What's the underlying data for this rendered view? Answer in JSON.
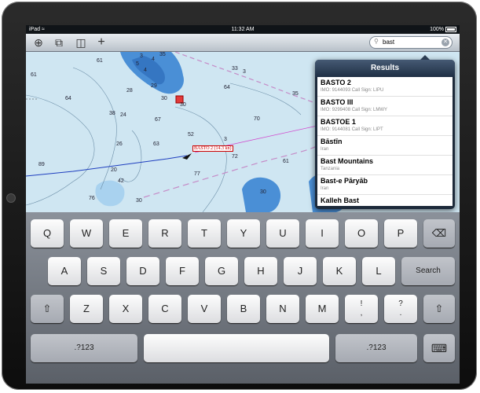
{
  "status_bar": {
    "device": "iPad",
    "wifi_icon": "wifi-icon",
    "time": "11:32 AM",
    "battery": "100%"
  },
  "toolbar": {
    "icons": [
      "location-target-icon",
      "layers-icon",
      "book-icon",
      "add-icon"
    ],
    "search": {
      "value": "bast",
      "icon": "search-icon",
      "clear_icon": "clear-icon"
    }
  },
  "map": {
    "depths": [
      "61",
      "3",
      "4",
      "35",
      "5",
      "4",
      "61",
      "33",
      "3",
      "64",
      "29",
      "30",
      "28",
      "64",
      "30",
      "35",
      "38",
      "24",
      "67",
      "70",
      "26",
      "63",
      "52",
      "3",
      "72",
      "89",
      "20",
      "42",
      "77",
      "76",
      "30",
      "61",
      "30"
    ],
    "vessel_label": "BASTO 2 (14.3 kn)"
  },
  "results_panel": {
    "title": "Results",
    "items": [
      {
        "name": "BASTO 2",
        "sub": "IMO: 9144093 Call Sign: LIPU"
      },
      {
        "name": "BASTO III",
        "sub": "IMO: 9299408 Call Sign: LMWY"
      },
      {
        "name": "BASTOE 1",
        "sub": "IMO: 9144081 Call Sign: LIPT"
      },
      {
        "name": "Bāstīn",
        "sub": "Iran"
      },
      {
        "name": "Bast Mountains",
        "sub": "Tanzania"
      },
      {
        "name": "Bast-e Pāryāb",
        "sub": "Iran"
      },
      {
        "name": "Kalleh Bast",
        "sub": ""
      }
    ]
  },
  "keyboard": {
    "row1": [
      "Q",
      "W",
      "E",
      "R",
      "T",
      "Y",
      "U",
      "I",
      "O",
      "P"
    ],
    "backspace_icon": "backspace-icon",
    "row2": [
      "A",
      "S",
      "D",
      "F",
      "G",
      "H",
      "J",
      "K",
      "L"
    ],
    "search_key": "Search",
    "shift_icon": "shift-icon",
    "row3": [
      "Z",
      "X",
      "C",
      "V",
      "B",
      "N",
      "M"
    ],
    "punct1": {
      "top": "!",
      "bottom": ","
    },
    "punct2": {
      "top": "?",
      "bottom": "."
    },
    "numbers_left": ".?123",
    "numbers_right": ".?123",
    "hide_keyboard_icon": "keyboard-hide-icon"
  }
}
